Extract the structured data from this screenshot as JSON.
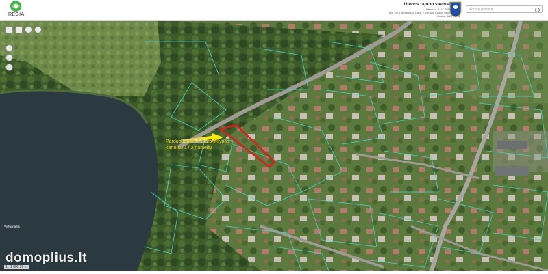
{
  "header": {
    "brand": "REGIA",
    "municipality_name": "Utenos rajono savivaldybė",
    "municipality_address": "Utenio a. 4, LT-28503 Utena",
    "municipality_contacts": "Tel. +370 389 61600, Faks. +370 389 61600, info@utena.lt",
    "municipality_code": "Kodas: 188770442",
    "search_placeholder": "Adresų paieška"
  },
  "map": {
    "callout_line1": "Parduodamas 7,6 aro sklypas",
    "callout_line2": "karto su 1 / 2 namelių",
    "watermark": "domoplius.lt",
    "scale_text": "1 : 1 000    20 m",
    "lake_label": "Vyžuonaitis",
    "tools": [
      "layers-icon",
      "print-icon",
      "zoom-icon",
      "locate-icon",
      "measure-icon",
      "info-icon",
      "draw-icon"
    ],
    "colors": {
      "parcel_highlight": "#e21b1b",
      "cadastre_lines": "#44d4c8",
      "callout_text": "#ffeb00",
      "arrow": "#ffeb00"
    }
  }
}
